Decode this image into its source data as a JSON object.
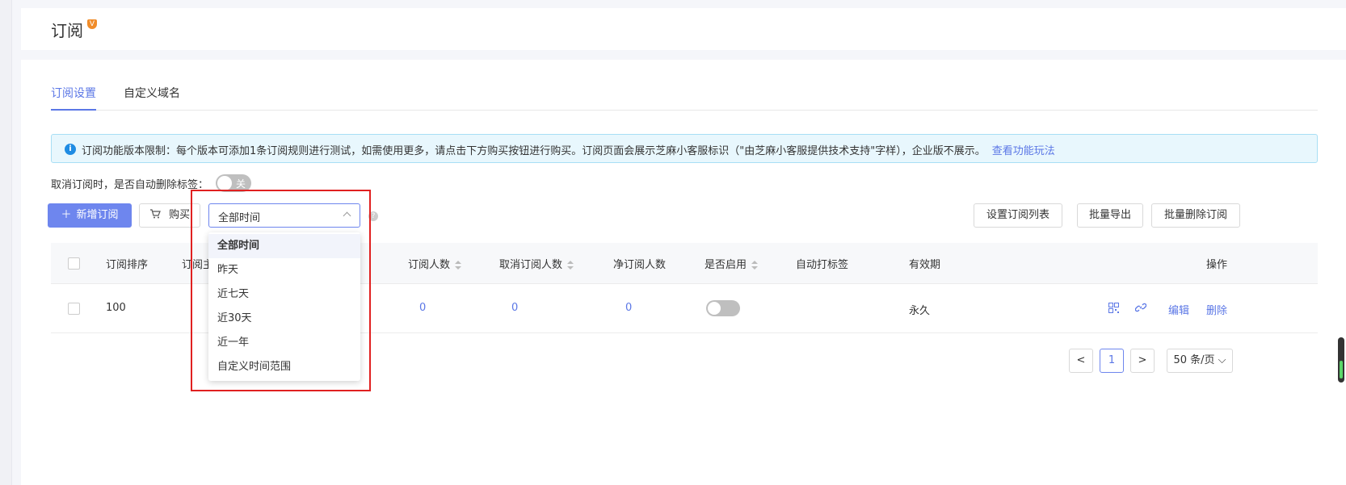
{
  "header": {
    "title": "订阅",
    "vip_badge": "V"
  },
  "tabs": [
    {
      "label": "订阅设置",
      "active": true
    },
    {
      "label": "自定义域名",
      "active": false
    }
  ],
  "notice": {
    "icon": "info-icon",
    "text": "订阅功能版本限制：每个版本可添加1条订阅规则进行测试，如需使用更多，请点击下方购买按钮进行购买。订阅页面会展示芝麻小客服标识（\"由芝麻小客服提供技术支持\"字样），企业版不展示。",
    "link": "查看功能玩法"
  },
  "auto_delete": {
    "label": "取消订阅时，是否自动删除标签：",
    "switch_text": "关",
    "enabled": false
  },
  "toolbar": {
    "add_label": "新增订阅",
    "buy_label": "购买",
    "time_filter": "全部时间",
    "set_list_label": "设置订阅列表",
    "export_label": "批量导出",
    "batch_delete_label": "批量删除订阅"
  },
  "dropdown": {
    "options": [
      "全部时间",
      "昨天",
      "近七天",
      "近30天",
      "近一年",
      "自定义时间范围"
    ],
    "selected": "全部时间"
  },
  "table": {
    "columns": {
      "order": "订阅排序",
      "subject": "订阅主",
      "subscribers": "订阅人数",
      "unsubscribers": "取消订阅人数",
      "net": "净订阅人数",
      "enabled": "是否启用",
      "auto_tag": "自动打标签",
      "validity": "有效期",
      "actions": "操作"
    },
    "rows": [
      {
        "order": "100",
        "subscribers": "0",
        "unsubscribers": "0",
        "net": "0",
        "enabled": false,
        "auto_tag": "",
        "validity": "永久",
        "edit": "编辑",
        "delete": "删除"
      }
    ]
  },
  "pagination": {
    "current": "1",
    "page_size": "50 条/页",
    "prev": "<",
    "next": ">"
  },
  "colors": {
    "primary": "#6e86ee",
    "link": "#5b77e6",
    "highlight": "#e02020"
  }
}
